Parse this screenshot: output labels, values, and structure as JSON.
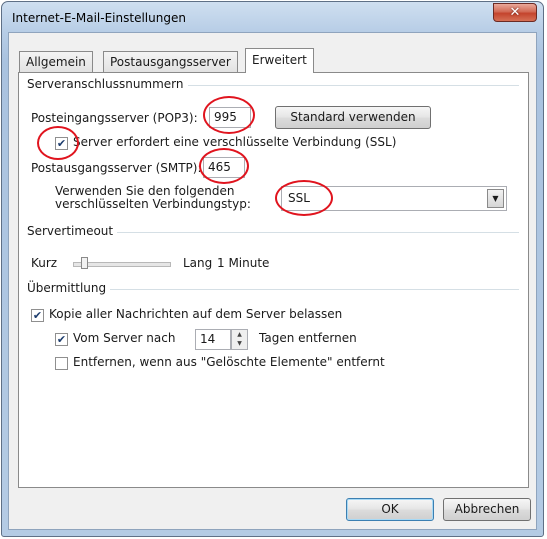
{
  "window": {
    "title": "Internet-E-Mail-Einstellungen",
    "close_icon": "close-icon"
  },
  "tabs": [
    {
      "label": "Allgemein",
      "active": false
    },
    {
      "label": "Postausgangsserver",
      "active": false
    },
    {
      "label": "Erweitert",
      "active": true
    }
  ],
  "server_ports": {
    "group_title": "Serveranschlussnummern",
    "pop3_label": "Posteingangsserver (POP3):",
    "pop3_value": "995",
    "default_button": "Standard verwenden",
    "ssl_checkbox_label": "Server erfordert eine verschlüsselte Verbindung (SSL)",
    "ssl_checked": true,
    "smtp_label": "Postausgangsserver (SMTP):",
    "smtp_value": "465",
    "encryption_label_line1": "Verwenden Sie den folgenden",
    "encryption_label_line2": "verschlüsselten Verbindungstyp:",
    "encryption_value": "SSL"
  },
  "timeout": {
    "group_title": "Servertimeout",
    "short_label": "Kurz",
    "long_label": "Lang",
    "value": "1 Minute",
    "level": 0.0
  },
  "delivery": {
    "group_title": "Übermittlung",
    "keep_copy_label": "Kopie aller Nachrichten auf dem Server belassen",
    "keep_copy_checked": true,
    "remove_after_label_prefix": "Vom Server nach",
    "remove_after_days": "14",
    "remove_after_label_suffix": "Tagen entfernen",
    "remove_after_checked": true,
    "remove_deleted_label": "Entfernen, wenn aus \"Gelöschte Elemente\" entfernt",
    "remove_deleted_checked": false
  },
  "footer": {
    "ok_label": "OK",
    "cancel_label": "Abbrechen"
  },
  "colors": {
    "annotation_red": "#e0141e",
    "window_frame": "#a9c2df"
  }
}
